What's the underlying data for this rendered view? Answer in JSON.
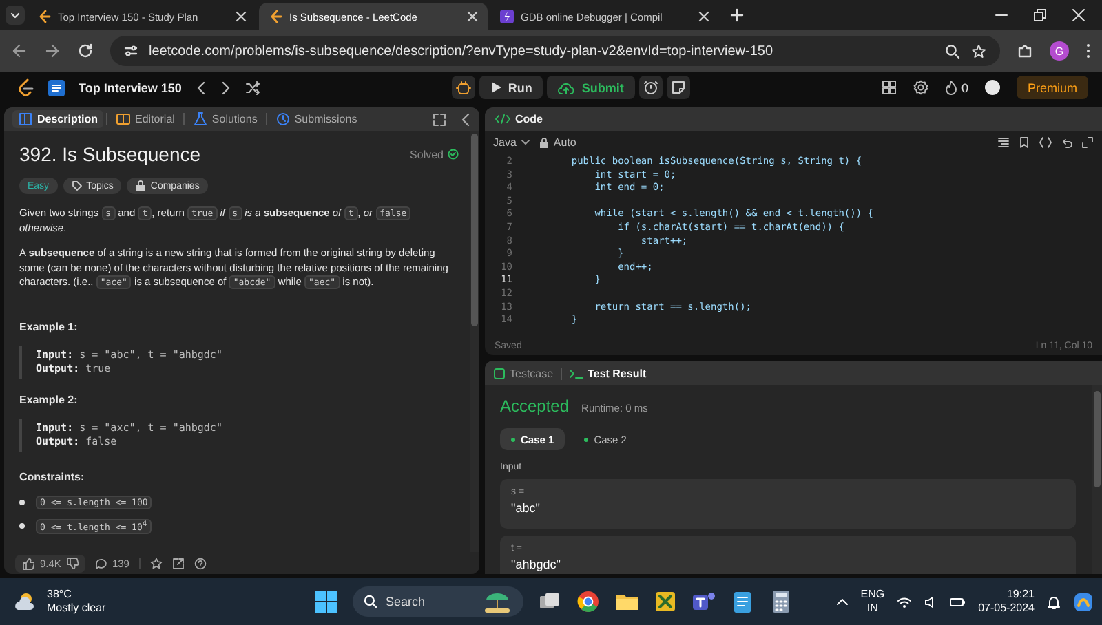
{
  "browser": {
    "tabs": [
      {
        "title": "Top Interview 150 - Study Plan",
        "selected": false
      },
      {
        "title": "Is Subsequence - LeetCode",
        "selected": true
      },
      {
        "title": "GDB online Debugger | Compil",
        "selected": false
      }
    ],
    "url": "leetcode.com/problems/is-subsequence/description/?envType=study-plan-v2&envId=top-interview-150",
    "profile_initial": "G"
  },
  "header": {
    "list_title": "Top Interview 150",
    "run": "Run",
    "submit": "Submit",
    "streak": "0",
    "premium": "Premium"
  },
  "description_panel": {
    "tabs": [
      {
        "label": "Description",
        "selected": true
      },
      {
        "label": "Editorial",
        "selected": false
      },
      {
        "label": "Solutions",
        "selected": false
      },
      {
        "label": "Submissions",
        "selected": false
      }
    ],
    "title": "392. Is Subsequence",
    "status": "Solved",
    "tags": [
      {
        "label": "Easy",
        "kind": "difficulty"
      },
      {
        "label": "Topics",
        "kind": "topics"
      },
      {
        "label": "Companies",
        "kind": "companies"
      }
    ],
    "paragraphs": [
      [
        {
          "kind": "text",
          "text": "Given two strings "
        },
        {
          "kind": "code",
          "text": "s"
        },
        {
          "kind": "text",
          "text": " and "
        },
        {
          "kind": "code",
          "text": "t"
        },
        {
          "kind": "text",
          "text": ", return "
        },
        {
          "kind": "code",
          "text": "true"
        },
        {
          "kind": "text",
          "text": " *if* "
        },
        {
          "kind": "code",
          "text": "s"
        },
        {
          "kind": "text",
          "text": " *is a* **subsequence** *of* "
        },
        {
          "kind": "code",
          "text": "t"
        },
        {
          "kind": "text",
          "text": ", *or* "
        },
        {
          "kind": "code",
          "text": "false"
        },
        {
          "kind": "text",
          "text": " *otherwise*."
        }
      ],
      [
        {
          "kind": "text",
          "text": "A **subsequence** of a string is a new string that is formed from the original string by deleting some (can be none) of the characters without disturbing the relative positions of the remaining characters. (i.e., "
        },
        {
          "kind": "code",
          "text": "\"ace\""
        },
        {
          "kind": "text",
          "text": " is a subsequence of "
        },
        {
          "kind": "code",
          "text": "\"abcde\""
        },
        {
          "kind": "text",
          "text": " while "
        },
        {
          "kind": "code",
          "text": "\"aec\""
        },
        {
          "kind": "text",
          "text": " is not)."
        }
      ]
    ],
    "examples": [
      {
        "heading": "Example 1:",
        "lines": [
          {
            "label": "Input:",
            "value": "s = \"abc\", t = \"ahbgdc\""
          },
          {
            "label": "Output:",
            "value": "true"
          }
        ]
      },
      {
        "heading": "Example 2:",
        "lines": [
          {
            "label": "Input:",
            "value": "s = \"axc\", t = \"ahbgdc\""
          },
          {
            "label": "Output:",
            "value": "false"
          }
        ]
      }
    ],
    "constraints_heading": "Constraints:",
    "constraints": [
      "0 <= s.length <= 100",
      "0 <= t.length <= 10$^{4}$"
    ],
    "footer": {
      "likes": "9.4K",
      "comments": "139"
    }
  },
  "code_panel": {
    "title": "Code",
    "language": "Java",
    "mode": "Auto",
    "lines": [
      {
        "number": "2",
        "text": "    public boolean isSubsequence(String s, String t) {",
        "current": false
      },
      {
        "number": "3",
        "text": "        int start = 0;",
        "current": false
      },
      {
        "number": "4",
        "text": "        int end = 0;",
        "current": false
      },
      {
        "number": "5",
        "current": false
      },
      {
        "number": "6",
        "text": "        while (start < s.length() && end < t.length()) {",
        "current": false
      },
      {
        "number": "7",
        "text": "            if (s.charAt(start) == t.charAt(end)) {",
        "current": false
      },
      {
        "number": "8",
        "text": "                start++;",
        "current": false
      },
      {
        "number": "9",
        "text": "            }",
        "current": false
      },
      {
        "number": "10",
        "text": "            end++;",
        "current": false
      },
      {
        "number": "11",
        "text": "        }",
        "current": true
      },
      {
        "number": "12",
        "current": false
      },
      {
        "number": "13",
        "text": "        return start == s.length();",
        "current": false
      },
      {
        "number": "14",
        "text": "    }",
        "current": false
      }
    ],
    "status": "Saved",
    "cursor": "Ln 11, Col 10"
  },
  "result_panel": {
    "tabs": [
      {
        "label": "Testcase",
        "selected": false
      },
      {
        "label": "Test Result",
        "selected": true
      }
    ],
    "verdict": "Accepted",
    "runtime": "Runtime: 0 ms",
    "cases": [
      {
        "label": "Case 1",
        "selected": true,
        "passed": true
      },
      {
        "label": "Case 2",
        "selected": false,
        "passed": true
      }
    ],
    "input_label": "Input",
    "inputs": [
      {
        "name": "s =",
        "value": "\"abc\""
      },
      {
        "name": "t =",
        "value": "\"ahbgdc\""
      }
    ]
  },
  "taskbar": {
    "weather_temp": "38°C",
    "weather_text": "Mostly clear",
    "search_placeholder": "Search",
    "language": "ENG",
    "region": "IN",
    "time": "19:21",
    "date": "07-05-2024"
  }
}
